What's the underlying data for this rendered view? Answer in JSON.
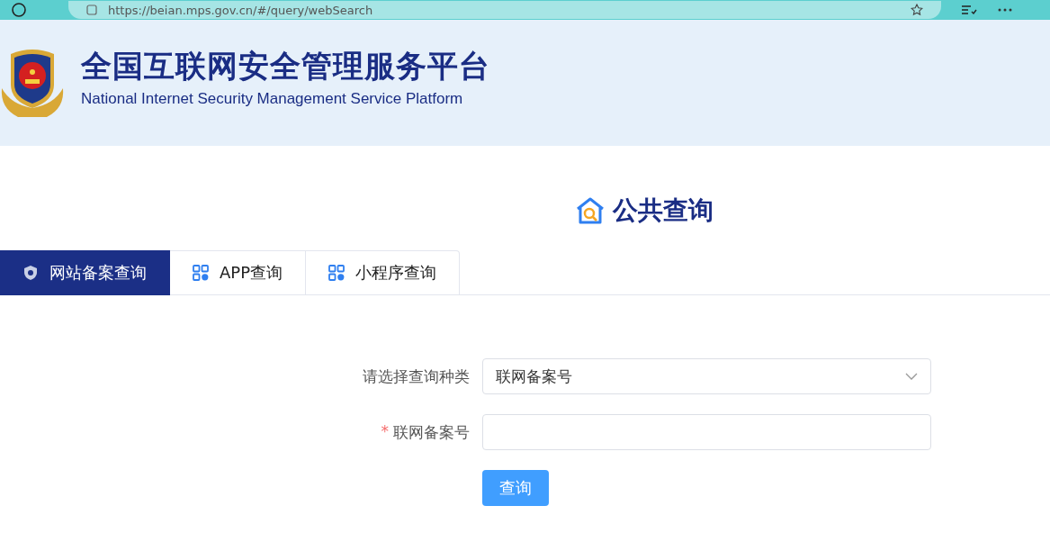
{
  "browser": {
    "url": "https://beian.mps.gov.cn/#/query/webSearch"
  },
  "header": {
    "title": "全国互联网安全管理服务平台",
    "subtitle": "National Internet Security Management Service Platform"
  },
  "page_title": "公共查询",
  "tabs": [
    {
      "label": "网站备案查询",
      "selected": true,
      "kind": "website"
    },
    {
      "label": "APP查询",
      "selected": false,
      "kind": "app"
    },
    {
      "label": "小程序查询",
      "selected": false,
      "kind": "app"
    }
  ],
  "form": {
    "fields": [
      {
        "kind": "select",
        "label": "请选择查询种类",
        "value": "联网备案号"
      },
      {
        "kind": "input",
        "label": "联网备案号",
        "required_mark": "*"
      }
    ],
    "submit": "查询"
  }
}
